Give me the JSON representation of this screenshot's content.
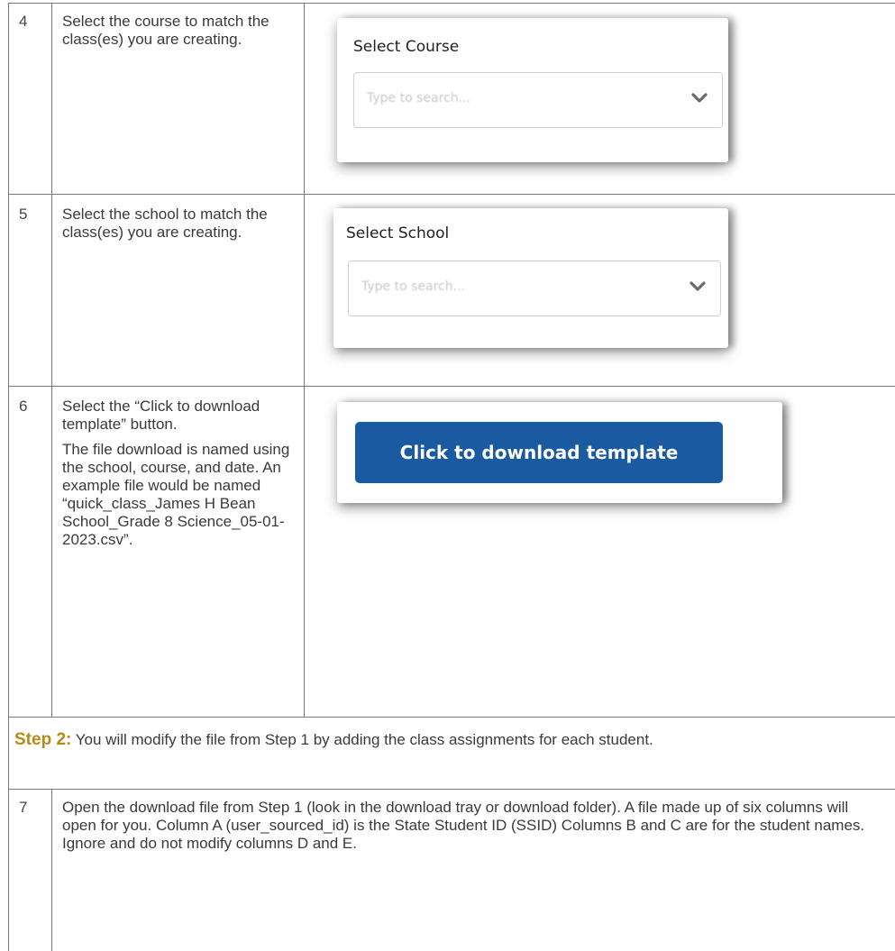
{
  "rows": [
    {
      "number": "4",
      "instruction": "Select the course to match the class(es) you are creating.",
      "panel": {
        "label": "Select Course",
        "placeholder": "Type to search..."
      }
    },
    {
      "number": "5",
      "instruction": "Select the school to match the class(es) you are creating.",
      "panel": {
        "label": "Select School",
        "placeholder": "Type to search..."
      }
    },
    {
      "number": "6",
      "instruction": "Select the “Click to download template” button.",
      "instruction_detail": "The file download is named using the school, course, and date. An example file would be named “quick_class_James H Bean School_Grade 8 Science_05-01-2023.csv”.",
      "panel": {
        "button_label": "Click to download template"
      }
    }
  ],
  "step2": {
    "label": "Step 2:",
    "text": " You will modify the file from Step 1 by adding the class assignments for each student."
  },
  "row7": {
    "number": "7",
    "instruction": "Open the download file from Step 1 (look in the download tray or download folder). A file made up of six columns will open for you. Column A (user_sourced_id) is the State Student ID (SSID) Columns B and C are for the student names. Ignore and do not modify columns D and E."
  },
  "colors": {
    "button": "#1a5aa0",
    "step_label": "#b58a16",
    "border": "#7a7a7a"
  },
  "icons": [
    "chevron-down-icon"
  ]
}
